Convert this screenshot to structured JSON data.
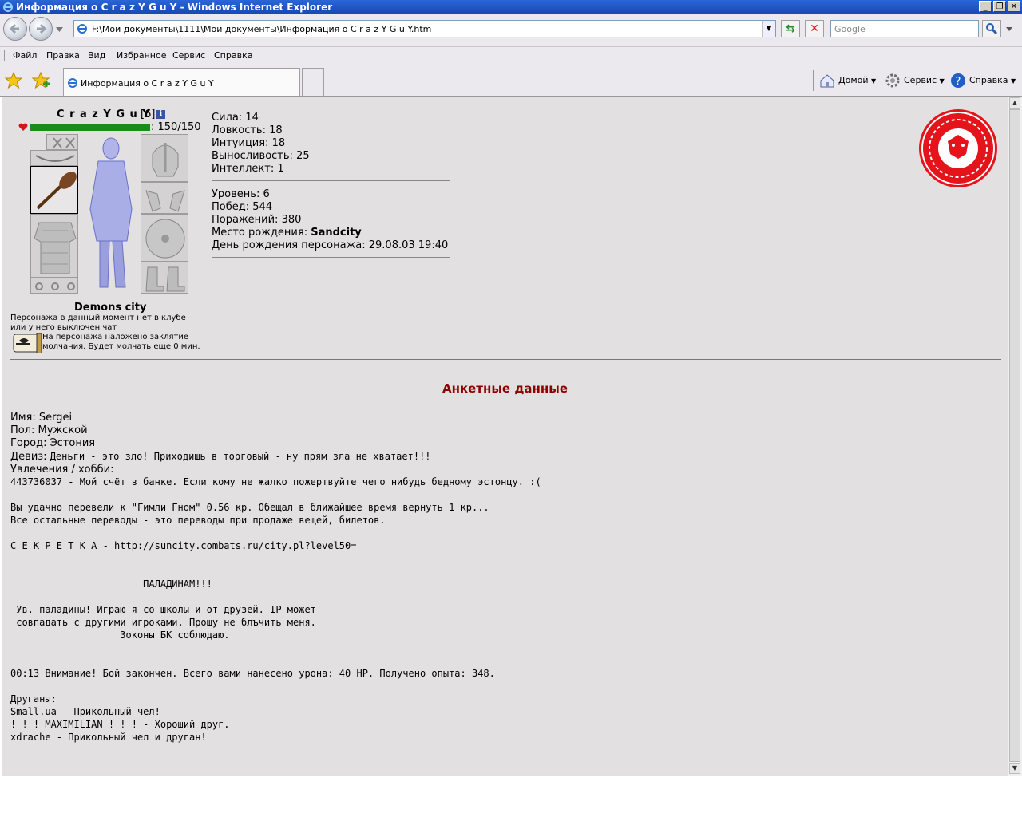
{
  "window": {
    "title": "Информация о C r a z Y G u Y - Windows Internet Explorer",
    "address": "F:\\Мои документы\\1111\\Мои документы\\Информация о C r a z Y G u Y.htm",
    "search_placeholder": "Google",
    "min_label": "_",
    "max_label": "❐",
    "close_label": "✕"
  },
  "menu": [
    "Файл",
    "Правка",
    "Вид",
    "Избранное",
    "Сервис",
    "Справка"
  ],
  "tab": {
    "label": "Информация о C r a z Y G u Y"
  },
  "commands": {
    "home": "Домой",
    "tools": "Сервис",
    "help": "Справка"
  },
  "character": {
    "name": "C r a z Y G u Y",
    "level": "[6]",
    "info_glyph": "i",
    "hp": 150,
    "hp_max": 150,
    "hp_text": ": 150/150",
    "city": "Demons city",
    "status": "Персонажа в данный момент нет в клубе или у него выключен чат",
    "silence": "На персонажа наложено заклятие молчания. Будет молчать еще 0 мин."
  },
  "stats": {
    "strength": "Сила: 14",
    "agility": "Ловкость: 18",
    "intuition": "Интуиция: 18",
    "endurance": "Выносливость: 25",
    "intellect": "Интеллект: 1",
    "level": "Уровень: 6",
    "wins": "Побед: 544",
    "losses": "Поражений: 380",
    "birthplace_label": "Место рождения: ",
    "birthplace": "Sandcity",
    "birthday": "День рождения персонажа: 29.08.03 19:40"
  },
  "profile": {
    "title": "Анкетные данные",
    "name": "Имя: Sergei",
    "gender": "Пол: Мужской",
    "city": "Город: Эстония",
    "motto_label": "Девиз: ",
    "motto": "Деньги - это зло! Приходишь в торговый - ну прям зла не хватает!!!",
    "hobby_label": "Увлечения / хобби:",
    "hobby_text": "443736037 - Мой счёт в банке. Если кому не жалко пожертвуйте чего нибудь бедному эстонцу. :(\n\nВы удачно перевели к \"Гимли Гном\" 0.56 кр. Обещал в ближайшее время вернуть 1 кр...\nВсе остальные переводы - это переводы при продаже вещей, билетов.\n\nС Е К Р Е Т К А - http://suncity.combats.ru/city.pl?level50=\n\n\n                       ПАЛАДИНАМ!!!\n\n Ув. паладины! Играю я со школы и от друзей. IP может\n совпадать с другими игроками. Прошу не блъчить меня.\n                   Зоконы БК соблюдаю.\n\n\n00:13 Внимание! Бой закончен. Всего вами нанесено урона: 40 HP. Получено опыта: 348.\n\nДруганы:\nSmall.ua - Прикольный чел!\n! ! ! MAXIMILIAN ! ! ! - Хороший друг.\nxdrache - Прикольный чел и друган!"
  },
  "colors": {
    "title_bar": "#1747b3",
    "content_bg": "#e2e0e0",
    "hp_bar": "#1d8a1d",
    "section_title": "#8b0000",
    "logo_red": "#e5141b"
  },
  "icons": {
    "back": "back-arrow-icon",
    "forward": "forward-arrow-icon",
    "refresh": "refresh-icon",
    "stop": "stop-icon",
    "search": "magnifier-icon",
    "favorites": "star-icon",
    "add_favorite": "add-favorite-icon",
    "home": "house-icon",
    "tools": "gear-icon",
    "help": "help-icon",
    "logo": "lion-emblem-icon"
  }
}
